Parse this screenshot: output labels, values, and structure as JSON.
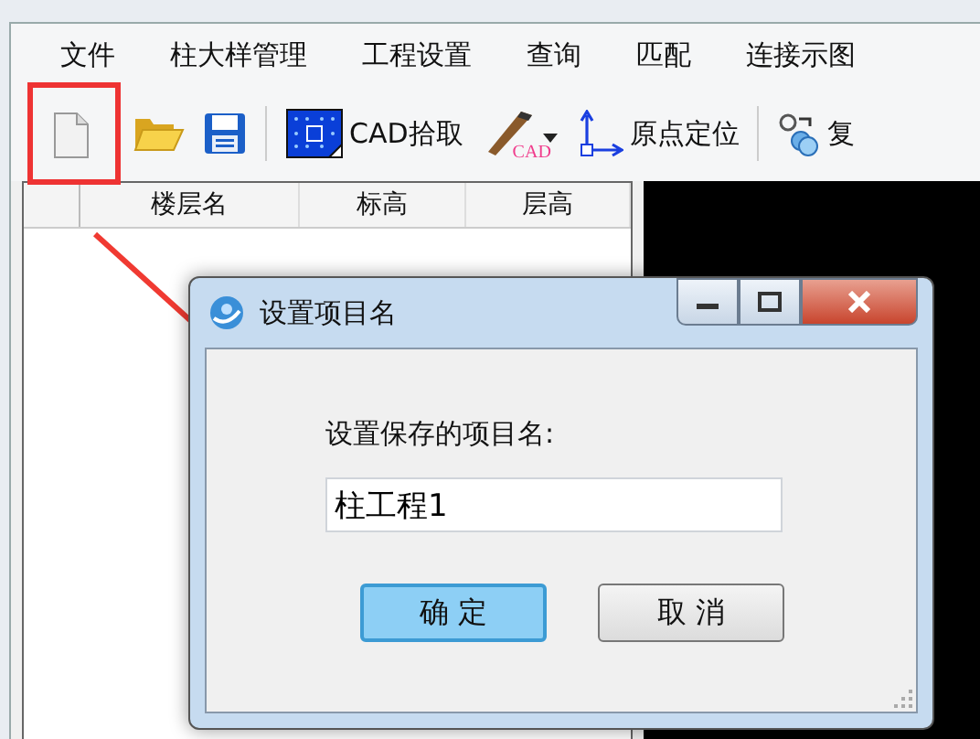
{
  "menu": [
    "文件",
    "柱大样管理",
    "工程设置",
    "查询",
    "匹配",
    "连接示图"
  ],
  "toolbar": [
    {
      "kind": "icon",
      "highlighted": true
    },
    {
      "kind": "icon",
      "highlighted": false
    },
    {
      "kind": "icon",
      "highlighted": false
    },
    {
      "kind": "separator"
    },
    {
      "kind": "button",
      "label": "CAD拾取",
      "highlighted": false
    },
    {
      "kind": "dropdown",
      "label": "CAD",
      "highlighted": false
    },
    {
      "kind": "button",
      "label": "原点定位",
      "highlighted": false
    },
    {
      "kind": "separator"
    },
    {
      "kind": "button",
      "label": "复",
      "highlighted": false
    }
  ],
  "table": {
    "columns": [
      "楼层名",
      "标高",
      "层高"
    ]
  },
  "dialog": {
    "title": "设置项目名",
    "label": "设置保存的项目名:",
    "input": {
      "value": "柱工程1"
    },
    "buttons": [
      {
        "label": "确 定",
        "default": true
      },
      {
        "label": "取 消",
        "default": false
      }
    ]
  }
}
